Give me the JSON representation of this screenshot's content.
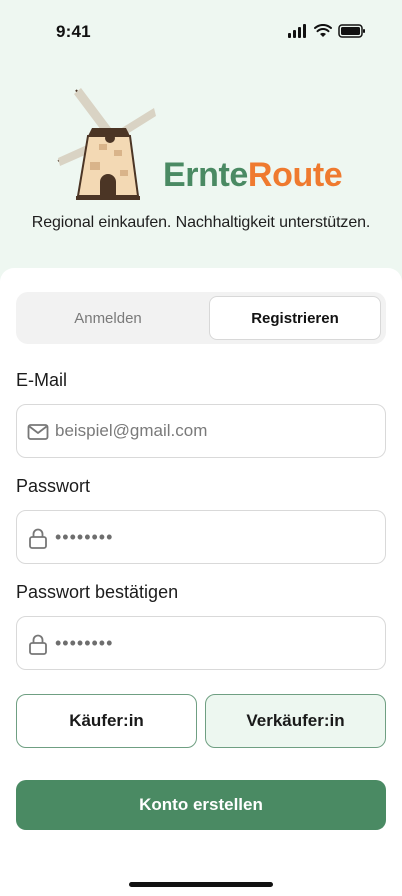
{
  "status_bar": {
    "time": "9:41"
  },
  "brand": {
    "part1": "Ernte",
    "part2": "Route",
    "tagline": "Regional einkaufen. Nachhaltigkeit unterstützen."
  },
  "tabs": {
    "login": "Anmelden",
    "register": "Registrieren",
    "active": "register"
  },
  "form": {
    "email_label": "E-Mail",
    "email_placeholder": "beispiel@gmail.com",
    "password_label": "Passwort",
    "password_value": "••••••••",
    "confirm_label": "Passwort bestätigen",
    "confirm_value": "••••••••"
  },
  "roles": {
    "buyer": "Käufer:in",
    "seller": "Verkäufer:in",
    "selected": "seller"
  },
  "actions": {
    "create_account": "Konto erstellen"
  },
  "colors": {
    "brand_green": "#4a8a63",
    "brand_orange": "#ef7a2f",
    "hero_bg": "#eef7f1"
  },
  "icons": {
    "email": "mail-icon",
    "password": "lock-icon",
    "signal": "signal-icon",
    "wifi": "wifi-icon",
    "battery": "battery-icon",
    "logo": "windmill-logo"
  }
}
